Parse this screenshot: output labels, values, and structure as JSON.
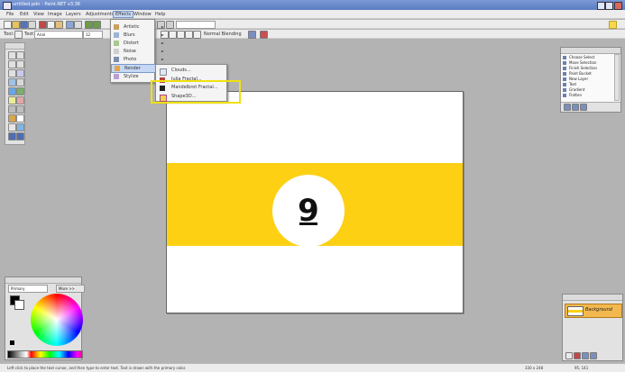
{
  "window": {
    "title": "untitled.pdn - Paint.NET v3.36"
  },
  "menubar": {
    "items": [
      "File",
      "Edit",
      "View",
      "Image",
      "Layers",
      "Adjustments",
      "Effects",
      "Window",
      "Help"
    ]
  },
  "toolbar2": {
    "tool_label": "Tool:",
    "text_label": "Text:",
    "font_value": "Arial",
    "size_value": "12",
    "rendering_label": "Normal",
    "mode_value": "Normal Blending"
  },
  "effects_menu": {
    "items": [
      {
        "label": "Artistic",
        "icon": "palette-icon"
      },
      {
        "label": "Blurs",
        "icon": "blur-icon"
      },
      {
        "label": "Distort",
        "icon": "distort-icon"
      },
      {
        "label": "Noise",
        "icon": "noise-icon"
      },
      {
        "label": "Photo",
        "icon": "camera-icon"
      },
      {
        "label": "Render",
        "icon": "render-icon"
      },
      {
        "label": "Stylize",
        "icon": "stylize-icon"
      }
    ],
    "highlighted": "Render"
  },
  "render_menu": {
    "items": [
      {
        "label": "Clouds...",
        "icon": "clouds-icon"
      },
      {
        "label": "Julia Fractal...",
        "icon": "fractal-icon"
      },
      {
        "label": "Mandelbrot Fractal...",
        "icon": "mandelbrot-icon"
      },
      {
        "label": "Shape3D...",
        "icon": "shape3d-icon"
      }
    ]
  },
  "canvas": {
    "ball_number": "9",
    "colors": {
      "stripe": "#fdd014",
      "background": "#ffffff"
    }
  },
  "history": {
    "items": [
      "Choose Select",
      "Move Selection",
      "Finish Selection",
      "Paint Bucket",
      "New Layer",
      "Text",
      "Gradient",
      "Flatten"
    ]
  },
  "colors_panel": {
    "mode_value": "Primary",
    "more_label": "More >>"
  },
  "layers_panel": {
    "layer_name": "Background"
  },
  "statusbar": {
    "message": "Left click to place the text cursor, and then type to enter text. Text is drawn with the primary color.",
    "size": "330 x 248",
    "position": "95, 141"
  }
}
